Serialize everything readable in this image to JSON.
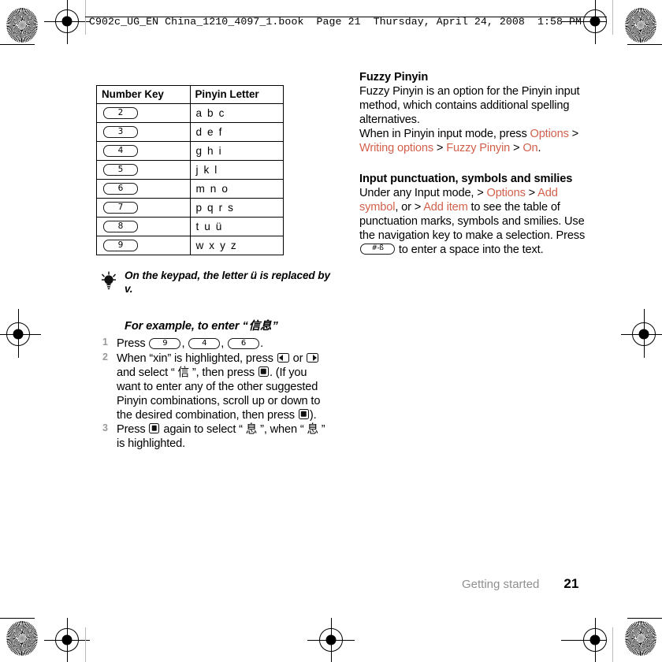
{
  "header": {
    "line": "C902c_UG_EN China_1210_4097_1.book  Page 21  Thursday, April 24, 2008  1:58 PM"
  },
  "table": {
    "columns": [
      "Number Key",
      "Pinyin Letter"
    ],
    "rows": [
      {
        "key": "2",
        "letters": "a b c"
      },
      {
        "key": "3",
        "letters": "d e f"
      },
      {
        "key": "4",
        "letters": "g h i"
      },
      {
        "key": "5",
        "letters": "j k l"
      },
      {
        "key": "6",
        "letters": "m n o"
      },
      {
        "key": "7",
        "letters": "p q r s"
      },
      {
        "key": "8",
        "letters": "t u ü"
      },
      {
        "key": "9",
        "letters": "w x y z"
      }
    ]
  },
  "tip": {
    "icon": "lightbulb-icon",
    "text": "On the keypad, the letter ü is replaced by v."
  },
  "example": {
    "lead": "For example, to enter “",
    "chinese": "信息",
    "trail": "”"
  },
  "steps": [
    {
      "num": "1",
      "parts": [
        {
          "t": "text",
          "v": "Press "
        },
        {
          "t": "key",
          "v": "9"
        },
        {
          "t": "text",
          "v": ", "
        },
        {
          "t": "key",
          "v": "4"
        },
        {
          "t": "text",
          "v": ", "
        },
        {
          "t": "key",
          "v": "6"
        },
        {
          "t": "text",
          "v": "."
        }
      ]
    },
    {
      "num": "2",
      "parts": [
        {
          "t": "text",
          "v": "When “xin” is highlighted, press "
        },
        {
          "t": "nav",
          "v": "left"
        },
        {
          "t": "text",
          "v": " or "
        },
        {
          "t": "nav",
          "v": "right"
        },
        {
          "t": "text",
          "v": " and select “ "
        },
        {
          "t": "cjk",
          "v": "信"
        },
        {
          "t": "text",
          "v": " ”, then press "
        },
        {
          "t": "nav",
          "v": "select"
        },
        {
          "t": "text",
          "v": ". (If you want to enter any of the other suggested Pinyin combinations, scroll up or down to the desired combination, then press "
        },
        {
          "t": "nav",
          "v": "select"
        },
        {
          "t": "text",
          "v": ")."
        }
      ]
    },
    {
      "num": "3",
      "parts": [
        {
          "t": "text",
          "v": "Press "
        },
        {
          "t": "nav",
          "v": "select"
        },
        {
          "t": "text",
          "v": " again to select “ "
        },
        {
          "t": "cjk",
          "v": "息"
        },
        {
          "t": "text",
          "v": " ”, when “ "
        },
        {
          "t": "cjk",
          "v": "息"
        },
        {
          "t": "text",
          "v": " ” is highlighted."
        }
      ]
    }
  ],
  "sections": [
    {
      "heading": "Fuzzy Pinyin",
      "paragraphs": [
        [
          {
            "t": "text",
            "v": "Fuzzy Pinyin is an option for the Pinyin input method, which contains additional spelling alternatives."
          }
        ],
        [
          {
            "t": "text",
            "v": "When in Pinyin input mode, press "
          },
          {
            "t": "menu",
            "v": "Options"
          },
          {
            "t": "text",
            "v": " > "
          },
          {
            "t": "menu",
            "v": "Writing options"
          },
          {
            "t": "text",
            "v": " > "
          },
          {
            "t": "menu",
            "v": "Fuzzy Pinyin"
          },
          {
            "t": "text",
            "v": " > "
          },
          {
            "t": "menu",
            "v": "On"
          },
          {
            "t": "text",
            "v": "."
          }
        ]
      ]
    },
    {
      "heading": "Input punctuation, symbols and smilies",
      "paragraphs": [
        [
          {
            "t": "text",
            "v": "Under any Input mode, > "
          },
          {
            "t": "menu",
            "v": "Options"
          },
          {
            "t": "text",
            "v": " > "
          },
          {
            "t": "menu",
            "v": "Add symbol"
          },
          {
            "t": "text",
            "v": ", or > "
          },
          {
            "t": "menu",
            "v": "Add item"
          },
          {
            "t": "text",
            "v": " to see the table of punctuation marks, symbols and smilies. Use the navigation key to make a selection. Press "
          },
          {
            "t": "hashkey",
            "v": "#-ß"
          },
          {
            "t": "text",
            "v": " to enter a space into the text."
          }
        ]
      ]
    }
  ],
  "footer": {
    "chapter": "Getting started",
    "page": "21"
  },
  "colors": {
    "menu_accent": "#d2604c",
    "footer_chapter": "#8f8f8f",
    "step_number": "#9a9a9a"
  }
}
